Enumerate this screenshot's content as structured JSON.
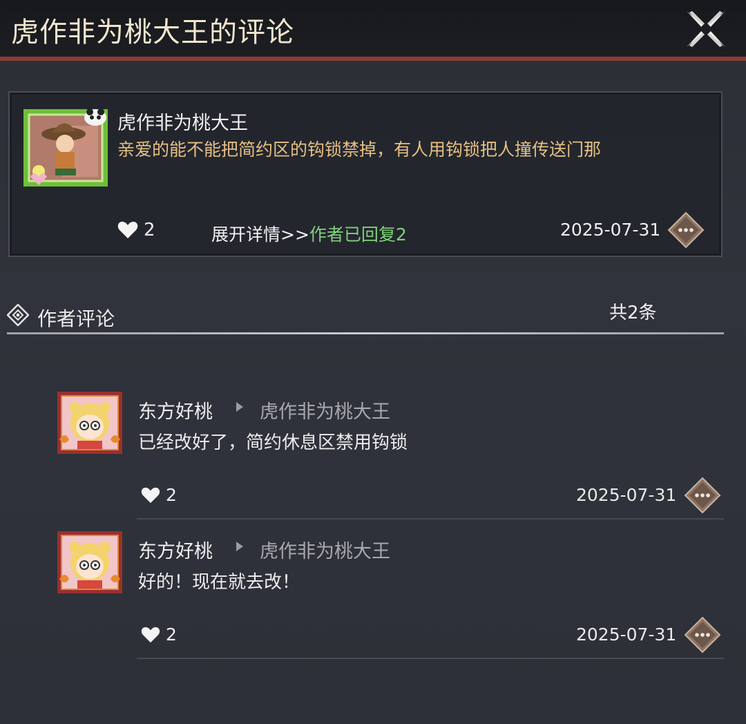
{
  "header": {
    "title": "虎作非为桃大王的评论",
    "close_icon": "close-x-icon"
  },
  "main_comment": {
    "username": "虎作非为桃大王",
    "content": "亲爱的能不能把简约区的钩锁禁掉，有人用钩锁把人撞传送门那",
    "likes": "2",
    "expand_label": "展开详情>>",
    "author_replied_label": "作者已回复2",
    "date": "2025-07-31",
    "avatar_icon": "avatar-straw-hat-character"
  },
  "section": {
    "title": "作者评论",
    "count": "共2条"
  },
  "replies": [
    {
      "author": "东方好桃",
      "target": "虎作非为桃大王",
      "text": "已经改好了，简约休息区禁用钩锁",
      "likes": "2",
      "date": "2025-07-31"
    },
    {
      "author": "东方好桃",
      "target": "虎作非为桃大王",
      "text": "好的！现在就去改！",
      "likes": "2",
      "date": "2025-07-31"
    }
  ],
  "colors": {
    "accent_gold": "#e6c083",
    "reply_green": "#7fd27a",
    "header_rule": "#8a3d33"
  }
}
